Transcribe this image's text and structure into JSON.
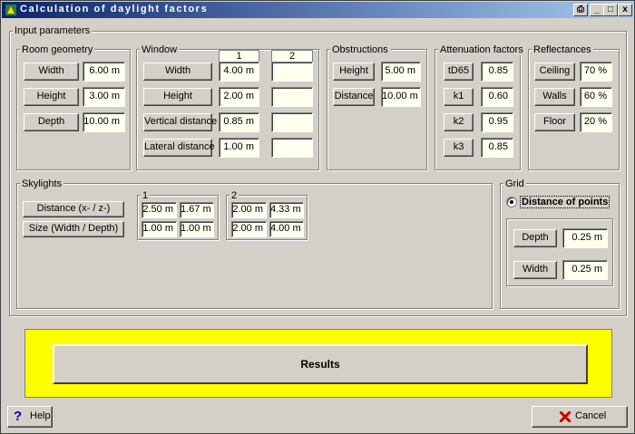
{
  "window": {
    "title": "Calculation of daylight factors",
    "controls": {
      "print": "⎙",
      "minimize": "_",
      "maximize": "□",
      "close": "x"
    }
  },
  "input_parameters": {
    "legend": "Input parameters",
    "room_geometry": {
      "legend": "Room geometry",
      "width_label": "Width",
      "width_value": "6.00 m",
      "height_label": "Height",
      "height_value": "3.00 m",
      "depth_label": "Depth",
      "depth_value": "10.00 m"
    },
    "window": {
      "legend": "Window",
      "col1": "1",
      "col2": "2",
      "rows": [
        {
          "label": "Width",
          "v1": "4.00 m",
          "v2": ""
        },
        {
          "label": "Height",
          "v1": "2.00 m",
          "v2": ""
        },
        {
          "label": "Vertical distance",
          "v1": "0.85 m",
          "v2": ""
        },
        {
          "label": "Lateral distance",
          "v1": "1.00 m",
          "v2": ""
        }
      ]
    },
    "obstructions": {
      "legend": "Obstructions",
      "height_label": "Height",
      "height_value": "5.00 m",
      "distance_label": "Distance",
      "distance_value": "10.00 m"
    },
    "attenuation": {
      "legend": "Attenuation factors",
      "rows": [
        {
          "label": "tD65",
          "value": "0.85"
        },
        {
          "label": "k1",
          "value": "0.60"
        },
        {
          "label": "k2",
          "value": "0.95"
        },
        {
          "label": "k3",
          "value": "0.85"
        }
      ]
    },
    "reflectances": {
      "legend": "Reflectances",
      "rows": [
        {
          "label": "Ceiling",
          "value": "70 %"
        },
        {
          "label": "Walls",
          "value": "60 %"
        },
        {
          "label": "Floor",
          "value": "20 %"
        }
      ]
    },
    "skylights": {
      "legend": "Skylights",
      "distance_label": "Distance (x- / z-)",
      "size_label": "Size (Width / Depth)",
      "s1": {
        "legend": "1",
        "dx": "2.50 m",
        "dz": "1.67 m",
        "w": "1.00 m",
        "d": "1.00 m"
      },
      "s2": {
        "legend": "2",
        "dx": "2.00 m",
        "dz": "4.33 m",
        "w": "2.00 m",
        "d": "4.00 m"
      }
    },
    "grid": {
      "legend": "Grid",
      "option_label": "Distance of points",
      "depth_label": "Depth",
      "depth_value": "0.25 m",
      "width_label": "Width",
      "width_value": "0.25 m"
    }
  },
  "actions": {
    "results_label": "Results",
    "help_label": "Help",
    "cancel_label": "Cancel"
  },
  "colors": {
    "field_background": "#ffffee",
    "results_panel": "#ffff00",
    "title_gradient_start": "#0a246a",
    "title_gradient_end": "#a6caf0",
    "cancel_icon": "#cc0000",
    "help_icon": "#0000cc"
  }
}
